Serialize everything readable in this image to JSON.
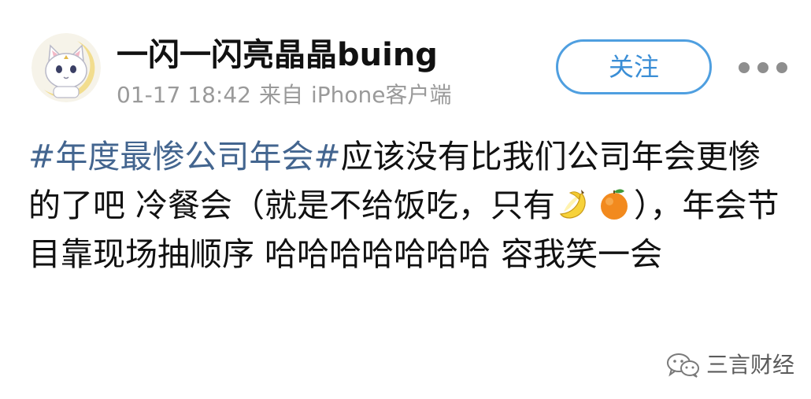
{
  "user": {
    "name": "一闪一闪亮晶晶buing",
    "avatar": "cat-with-crescent-moon-icon"
  },
  "meta": {
    "time": "01-17 18:42",
    "source_prefix": "来自",
    "source": "iPhone客户端"
  },
  "actions": {
    "follow_label": "关注",
    "more_icon": "ellipsis-icon"
  },
  "post": {
    "hashtag": "#年度最惨公司年会#",
    "text_1": "应该没有比我们公司年会更惨的了吧 冷餐会（就是不给饭吃，只有",
    "emojis": [
      "banana-icon",
      "tangerine-icon"
    ],
    "text_2": "），年会节目靠现场抽顺序 哈哈哈哈哈哈哈 容我笑一会"
  },
  "watermark": {
    "icon": "wechat-icon",
    "text": "三言财经"
  },
  "colors": {
    "hashtag": "#43658f",
    "follow": "#3a8ed6",
    "meta": "#9a9a9a"
  }
}
